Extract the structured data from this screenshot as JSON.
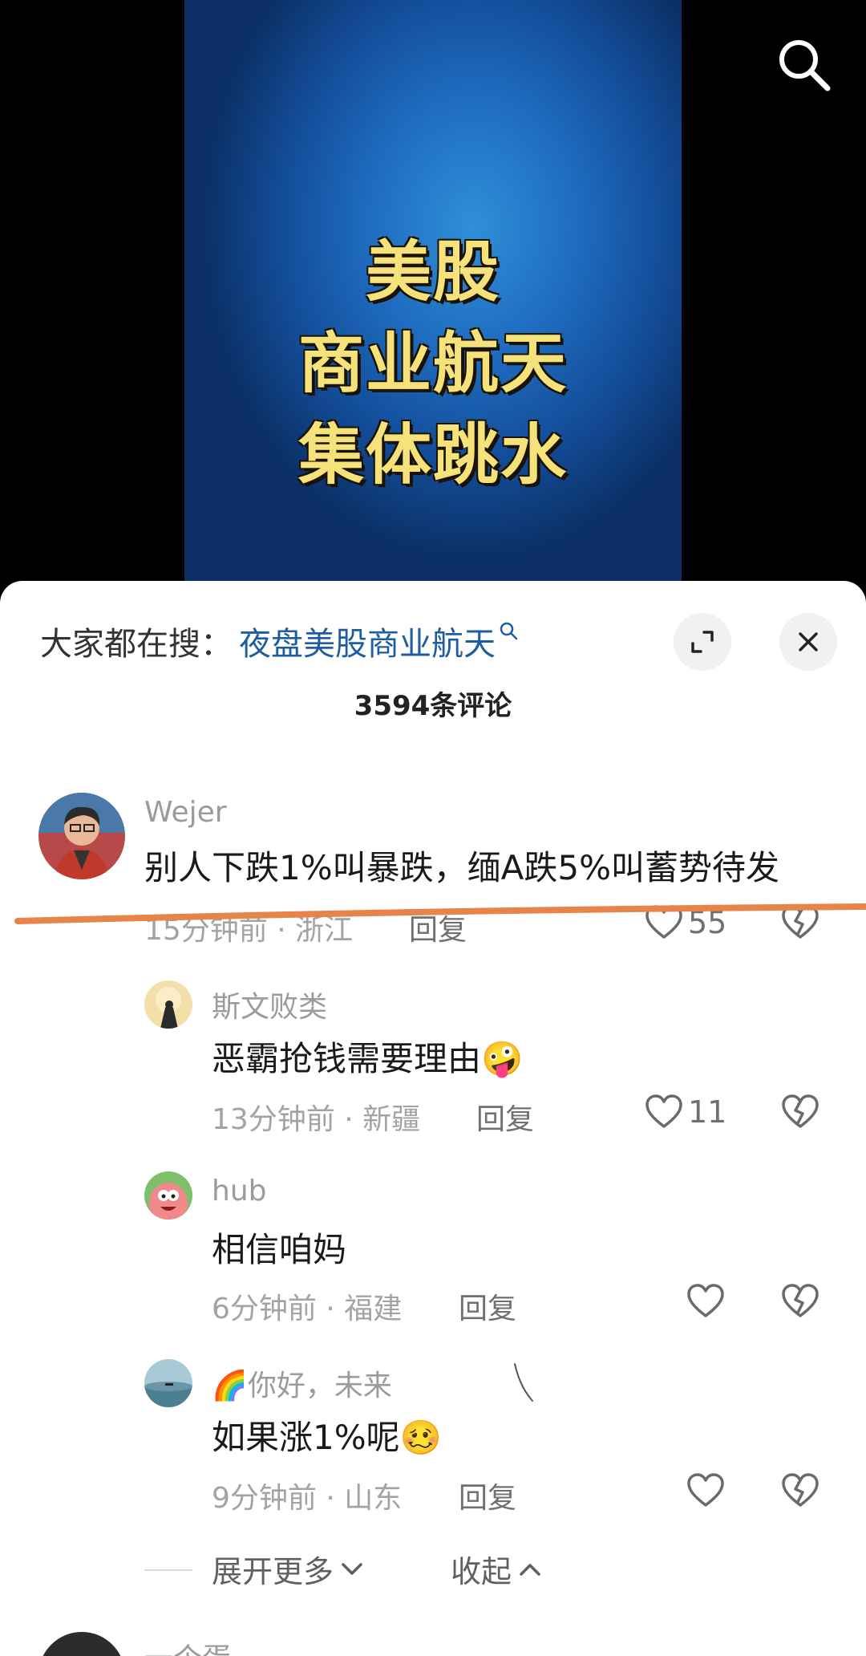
{
  "video": {
    "title_lines": [
      "美股",
      "商业航天",
      "集体跳水"
    ]
  },
  "trending": {
    "label": "大家都在搜：",
    "query": "夜盘美股商业航天"
  },
  "comments_count": "3594条评论",
  "comments": [
    {
      "username": "Wejer",
      "content": "别人下跌1%叫暴跌，缅A跌5%叫蓄势待发",
      "meta": "15分钟前 · 浙江",
      "reply": "回复",
      "likes": "55"
    }
  ],
  "replies": [
    {
      "username": "斯文败类",
      "content": "恶霸抢钱需要理由",
      "emoji": "🤪",
      "meta": "13分钟前 · 新疆",
      "reply": "回复",
      "likes": "11"
    },
    {
      "username": "hub",
      "content": "相信咱妈",
      "meta": "6分钟前 · 福建",
      "reply": "回复",
      "likes": ""
    },
    {
      "username": "🌈你好，未来",
      "content": "如果涨1%呢",
      "emoji": "🥴",
      "meta": "9分钟前 · 山东",
      "reply": "回复",
      "likes": ""
    }
  ],
  "actions": {
    "expand_more": "展开更多",
    "collapse": "收起"
  },
  "next_comment": {
    "username": "一个蛋"
  },
  "colors": {
    "accent_blue": "#1f5e9e",
    "annotation_orange": "#e8834a",
    "video_title": "#f6e27a"
  }
}
